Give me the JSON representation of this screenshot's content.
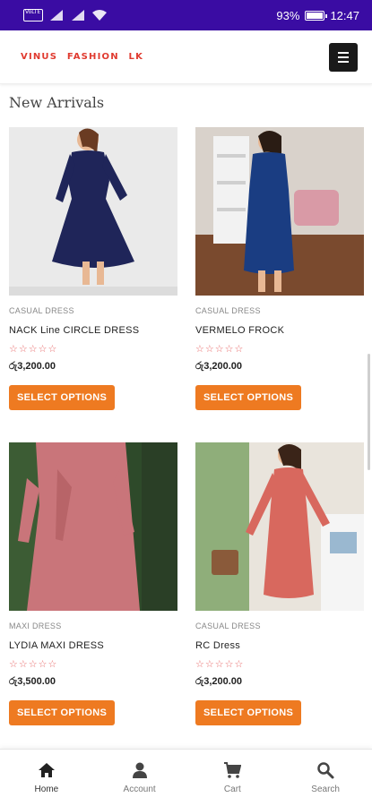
{
  "status_bar": {
    "sim_label": "VoLTE",
    "battery": "93%",
    "time": "12:47"
  },
  "header": {
    "logo": "VINUS FASHION LK"
  },
  "section": {
    "title": "New Arrivals"
  },
  "products": [
    {
      "category": "CASUAL DRESS",
      "name": "NACK Line CIRCLE DRESS",
      "rating": "☆☆☆☆☆",
      "price": "රු3,200.00",
      "button": "SELECT OPTIONS"
    },
    {
      "category": "CASUAL DRESS",
      "name": "VERMELO FROCK",
      "rating": "☆☆☆☆☆",
      "price": "රු3,200.00",
      "button": "SELECT OPTIONS"
    },
    {
      "category": "MAXI DRESS",
      "name": "LYDIA MAXI DRESS",
      "rating": "☆☆☆☆☆",
      "price": "රු3,500.00",
      "button": "SELECT OPTIONS"
    },
    {
      "category": "CASUAL DRESS",
      "name": "RC Dress",
      "rating": "☆☆☆☆☆",
      "price": "රු3,200.00",
      "button": "SELECT OPTIONS"
    }
  ],
  "bottom_nav": {
    "items": [
      {
        "label": "Home",
        "icon": "home-icon"
      },
      {
        "label": "Account",
        "icon": "account-icon"
      },
      {
        "label": "Cart",
        "icon": "cart-icon"
      },
      {
        "label": "Search",
        "icon": "search-icon"
      }
    ]
  },
  "colors": {
    "status_bar": "#3a0ca3",
    "logo": "#e03a2f",
    "button": "#ee7a21",
    "stars": "#e86a6a"
  }
}
